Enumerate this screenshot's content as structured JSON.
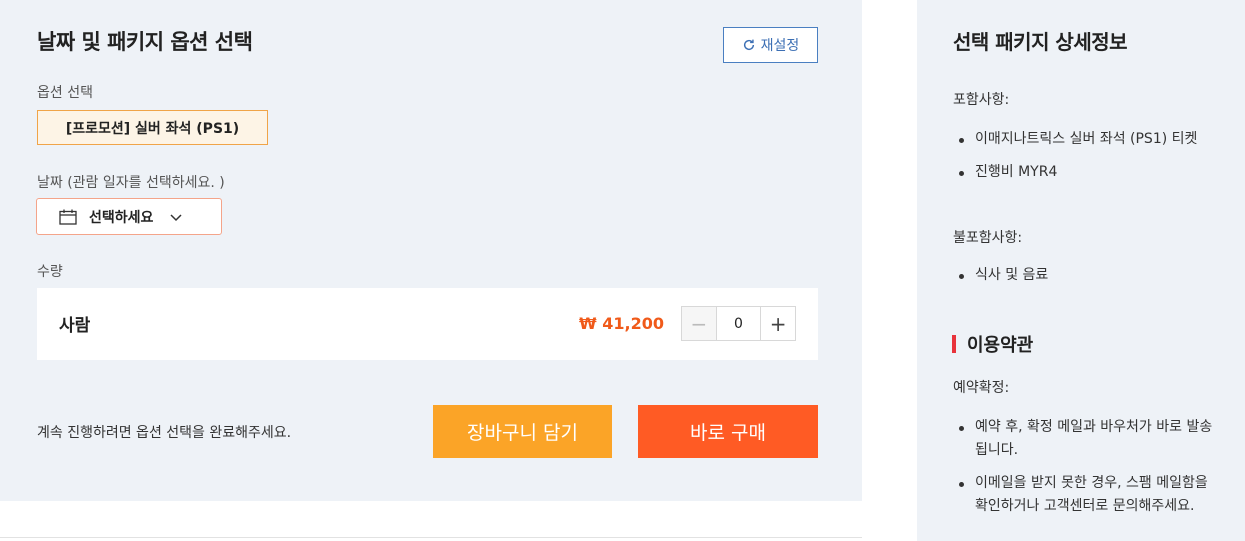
{
  "left": {
    "title": "날짜 및 패키지 옵션 선택",
    "reset_label": "재설정",
    "option_label": "옵션 선택",
    "option_selected": "[프로모션] 실버 좌석 (PS1)",
    "date_label": "날짜  (관람 일자를 선택하세요. )",
    "date_placeholder": "선택하세요",
    "qty_label": "수량",
    "qty_item": {
      "name": "사람",
      "price": "₩ 41,200",
      "count": "0",
      "minus": "−",
      "plus": "+"
    },
    "notice": "계속 진행하려면 옵션 선택을 완료해주세요.",
    "cart_button": "장바구니 담기",
    "buy_button": "바로 구매"
  },
  "right": {
    "title": "선택 패키지 상세정보",
    "included_label": "포함사항:",
    "included_items": [
      "이매지나트릭스 실버 좌석 (PS1) 티켓",
      "진행비 MYR4"
    ],
    "excluded_label": "불포함사항:",
    "excluded_items": [
      "식사 및 음료"
    ],
    "terms_title": "이용약관",
    "confirm_label": "예약확정:",
    "confirm_items": [
      "예약 후, 확정 메일과 바우처가 바로 발송됩니다.",
      "이메일을 받지 못한 경우, 스팸 메일함을 확인하거나 고객센터로 문의해주세요."
    ]
  },
  "icons": {
    "reset": "refresh-icon",
    "date": "calendar-icon",
    "dropdown": "chevron-down-icon"
  },
  "colors": {
    "accent_orange": "#ff5b24",
    "cart_yellow": "#fba427",
    "price": "#f05a1a",
    "reset_blue": "#3c6fb4",
    "terms_red": "#e8333b",
    "panel_bg": "#eef2f7"
  }
}
